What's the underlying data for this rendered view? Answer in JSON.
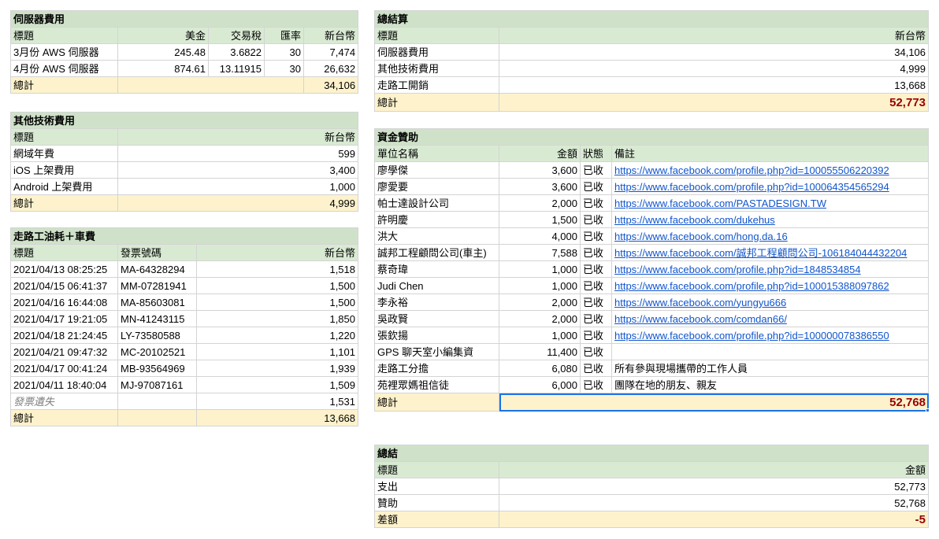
{
  "server_costs": {
    "title": "伺服器費用",
    "headers": [
      "標題",
      "美金",
      "交易稅",
      "匯率",
      "新台幣"
    ],
    "rows": [
      [
        "3月份 AWS 伺服器",
        "245.48",
        "3.6822",
        "30",
        "7,474"
      ],
      [
        "4月份 AWS 伺服器",
        "874.61",
        "13.11915",
        "30",
        "26,632"
      ]
    ],
    "total_label": "總計",
    "total_value": "34,106"
  },
  "other_tech": {
    "title": "其他技術費用",
    "headers": [
      "標題",
      "新台幣"
    ],
    "rows": [
      [
        "網域年費",
        "599"
      ],
      [
        "iOS 上架費用",
        "3,400"
      ],
      [
        "Android 上架費用",
        "1,000"
      ]
    ],
    "total_label": "總計",
    "total_value": "4,999"
  },
  "travel": {
    "title": "走路工油耗＋車費",
    "headers": [
      "標題",
      "發票號碼",
      "新台幣"
    ],
    "rows": [
      [
        "2021/04/13 08:25:25",
        "MA-64328294",
        "1,518"
      ],
      [
        "2021/04/15 06:41:37",
        "MM-07281941",
        "1,500"
      ],
      [
        "2021/04/16 16:44:08",
        "MA-85603081",
        "1,500"
      ],
      [
        "2021/04/17 19:21:05",
        "MN-41243115",
        "1,850"
      ],
      [
        "2021/04/18 21:24:45",
        "LY-73580588",
        "1,220"
      ],
      [
        "2021/04/21 09:47:32",
        "MC-20102521",
        "1,101"
      ],
      [
        "2021/04/17 00:41:24",
        "MB-93564969",
        "1,939"
      ],
      [
        "2021/04/11 18:40:04",
        "MJ-97087161",
        "1,509"
      ]
    ],
    "lost_label": "發票遺失",
    "lost_value": "1,531",
    "total_label": "總計",
    "total_value": "13,668"
  },
  "summary": {
    "title": "總結算",
    "headers": [
      "標題",
      "新台幣"
    ],
    "rows": [
      [
        "伺服器費用",
        "34,106"
      ],
      [
        "其他技術費用",
        "4,999"
      ],
      [
        "走路工開銷",
        "13,668"
      ]
    ],
    "total_label": "總計",
    "total_value": "52,773"
  },
  "funding": {
    "title": "資金贊助",
    "headers": [
      "單位名稱",
      "金額",
      "狀態",
      "備註"
    ],
    "rows": [
      [
        "廖學傑",
        "3,600",
        "已收",
        "https://www.facebook.com/profile.php?id=100055506220392"
      ],
      [
        "廖愛要",
        "3,600",
        "已收",
        "https://www.facebook.com/profile.php?id=100064354565294"
      ],
      [
        "帕士達設計公司",
        "2,000",
        "已收",
        "https://www.facebook.com/PASTADESIGN.TW"
      ],
      [
        "許明慶",
        "1,500",
        "已收",
        "https://www.facebook.com/dukehus"
      ],
      [
        "洪大",
        "4,000",
        "已收",
        "https://www.facebook.com/hong.da.16"
      ],
      [
        "誠邦工程顧問公司(車主)",
        "7,588",
        "已收",
        "https://www.facebook.com/誠邦工程顧問公司-106184044432204"
      ],
      [
        "蔡奇瑋",
        "1,000",
        "已收",
        "https://www.facebook.com/profile.php?id=1848534854"
      ],
      [
        "Judi Chen",
        "1,000",
        "已收",
        "https://www.facebook.com/profile.php?id=100015388097862"
      ],
      [
        "李永裕",
        "2,000",
        "已收",
        "https://www.facebook.com/yungyu666"
      ],
      [
        "吳政賢",
        "2,000",
        "已收",
        "https://www.facebook.com/comdan66/"
      ],
      [
        "張欽揚",
        "1,000",
        "已收",
        "https://www.facebook.com/profile.php?id=100000078386550"
      ],
      [
        "GPS 聊天室小編集資",
        "11,400",
        "已收",
        ""
      ],
      [
        "走路工分擔",
        "6,080",
        "已收",
        "所有參與現場攜帶的工作人員"
      ],
      [
        "苑裡眾媽祖信徒",
        "6,000",
        "已收",
        "團隊在地的朋友、親友"
      ]
    ],
    "link_rows": [
      0,
      1,
      2,
      3,
      4,
      5,
      6,
      7,
      8,
      9,
      10
    ],
    "total_label": "總計",
    "total_value": "52,768"
  },
  "conclusion": {
    "title": "總結",
    "headers": [
      "標題",
      "金額"
    ],
    "rows": [
      [
        "支出",
        "52,773"
      ],
      [
        "贊助",
        "52,768"
      ]
    ],
    "total_label": "差額",
    "total_value": "-5"
  }
}
